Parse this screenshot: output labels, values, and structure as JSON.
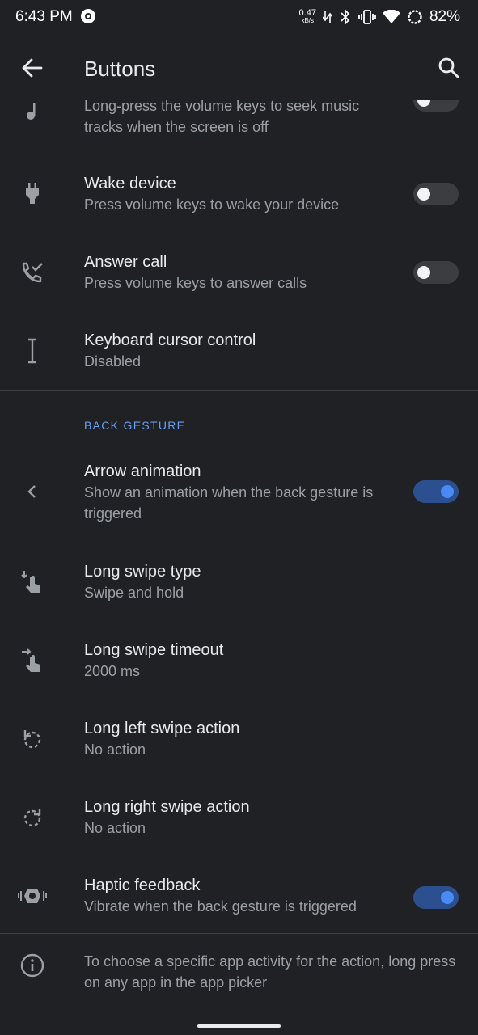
{
  "status_bar": {
    "time": "6:43 PM",
    "net_speed": "0.47",
    "net_speed_unit": "kB/s",
    "battery": "82%"
  },
  "app_bar": {
    "title": "Buttons",
    "back_icon": "arrow-back-icon",
    "search_icon": "search-icon"
  },
  "items_top": [
    {
      "icon": "music-note-icon",
      "title": "",
      "subtitle": "Long-press the volume keys to seek music tracks when the screen is off",
      "toggle": "off"
    },
    {
      "icon": "power-plug-icon",
      "title": "Wake device",
      "subtitle": "Press volume keys to wake your device",
      "toggle": "off"
    },
    {
      "icon": "phone-answer-icon",
      "title": "Answer call",
      "subtitle": "Press volume keys to answer calls",
      "toggle": "off"
    },
    {
      "icon": "text-cursor-icon",
      "title": "Keyboard cursor control",
      "subtitle": "Disabled",
      "toggle": null
    }
  ],
  "section": {
    "header": "BACK GESTURE"
  },
  "items_back": [
    {
      "icon": "chevron-left-icon",
      "title": "Arrow animation",
      "subtitle": "Show an animation when the back gesture is triggered",
      "toggle": "on"
    },
    {
      "icon": "swipe-hold-icon",
      "title": "Long swipe type",
      "subtitle": "Swipe and hold",
      "toggle": null
    },
    {
      "icon": "swipe-timeout-icon",
      "title": "Long swipe timeout",
      "subtitle": "2000 ms",
      "toggle": null
    },
    {
      "icon": "rotate-left-icon",
      "title": "Long left swipe action",
      "subtitle": "No action",
      "toggle": null
    },
    {
      "icon": "rotate-right-icon",
      "title": "Long right swipe action",
      "subtitle": "No action",
      "toggle": null
    },
    {
      "icon": "vibration-icon",
      "title": "Haptic feedback",
      "subtitle": "Vibrate when the back gesture is triggered",
      "toggle": "on"
    }
  ],
  "footer_info": {
    "icon": "info-icon",
    "text": "To choose a specific app activity for the action, long press on any app in the app picker"
  },
  "colors": {
    "background": "#202124",
    "accent": "#669df6",
    "toggle_on_track": "#2b4f8f",
    "toggle_on_knob": "#4a8af4",
    "toggle_off_track": "#3c3d40"
  }
}
